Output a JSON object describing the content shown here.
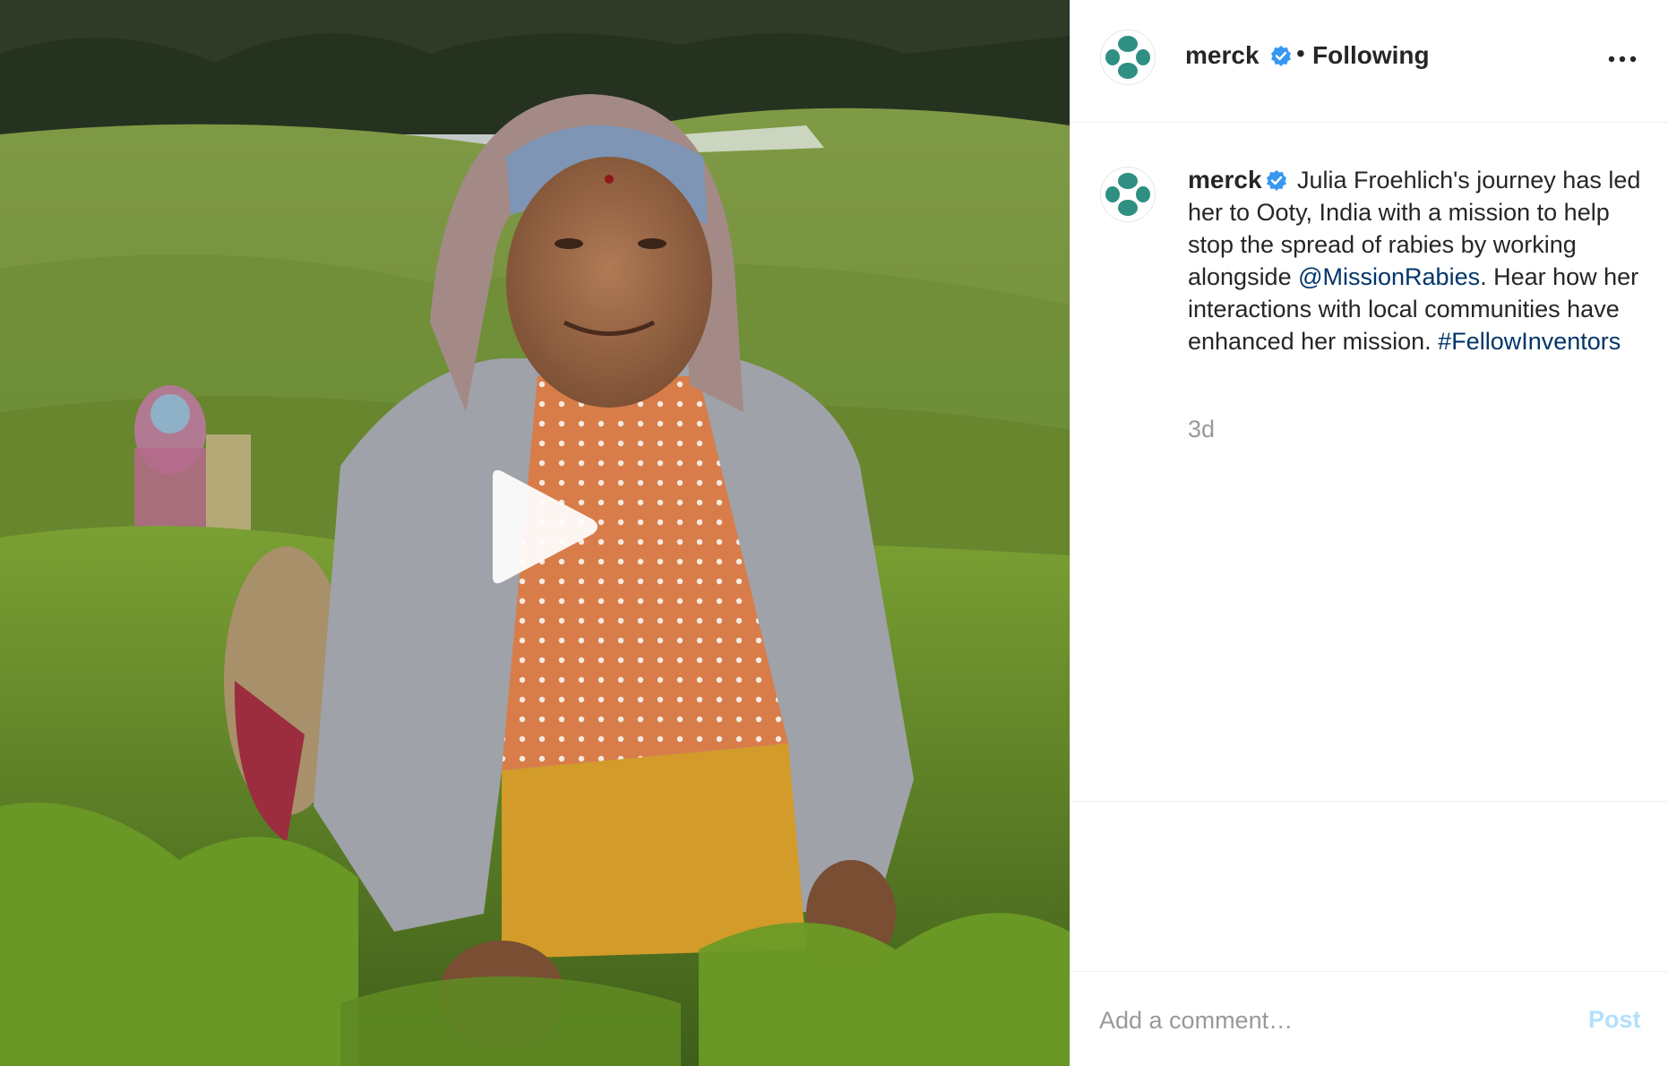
{
  "account": {
    "username": "merck",
    "verified": true,
    "follow_state": "Following",
    "separator": "•"
  },
  "header": {
    "more_icon": "more-horizontal-icon"
  },
  "caption": {
    "username": "merck",
    "text_part1": " Julia Froehlich's journey has led her to Ooty, India with a mission to help stop the spread of rabies by working alongside ",
    "mention": "@MissionRabies",
    "text_part2": ". Hear how her interactions with local communities have enhanced her mission. ",
    "hashtag": "#FellowInventors"
  },
  "timestamp": "3d",
  "comment": {
    "placeholder": "Add a comment…",
    "value": "",
    "post_label": "Post"
  },
  "media": {
    "type": "video",
    "play_icon": "play-icon"
  },
  "colors": {
    "brand_teal": "#2f8f83",
    "verified_blue": "#3897f0",
    "link_blue": "#003569",
    "post_disabled": "#b2dffc",
    "muted_text": "#999999"
  }
}
